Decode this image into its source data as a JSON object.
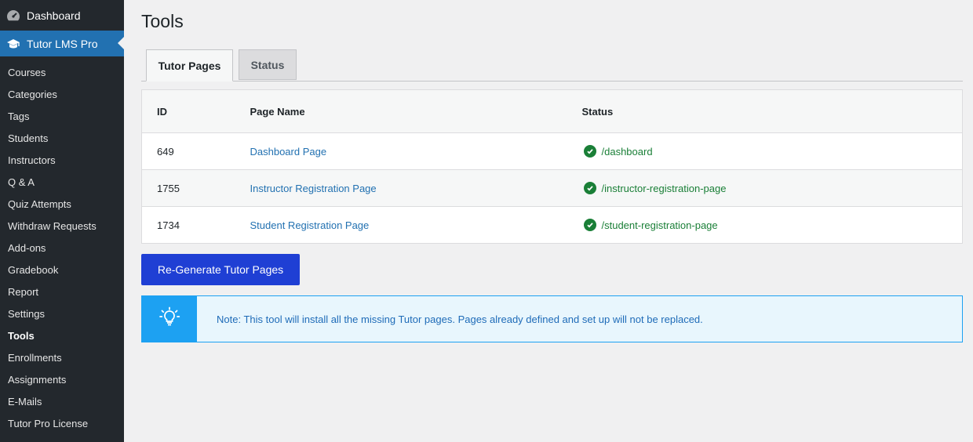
{
  "sidebar": {
    "dashboard": {
      "label": "Dashboard",
      "icon": "dashboard-icon"
    },
    "plugin": {
      "label": "Tutor LMS Pro",
      "icon": "graduation-cap-icon"
    },
    "items": [
      {
        "label": "Courses"
      },
      {
        "label": "Categories"
      },
      {
        "label": "Tags"
      },
      {
        "label": "Students"
      },
      {
        "label": "Instructors"
      },
      {
        "label": "Q & A"
      },
      {
        "label": "Quiz Attempts"
      },
      {
        "label": "Withdraw Requests"
      },
      {
        "label": "Add-ons"
      },
      {
        "label": "Gradebook"
      },
      {
        "label": "Report"
      },
      {
        "label": "Settings"
      },
      {
        "label": "Tools"
      },
      {
        "label": "Enrollments"
      },
      {
        "label": "Assignments"
      },
      {
        "label": "E-Mails"
      },
      {
        "label": "Tutor Pro License"
      }
    ],
    "current": "Tools"
  },
  "page": {
    "title": "Tools"
  },
  "tabs": [
    {
      "label": "Tutor Pages",
      "active": true
    },
    {
      "label": "Status",
      "active": false
    }
  ],
  "table": {
    "headers": {
      "id": "ID",
      "name": "Page Name",
      "status": "Status"
    },
    "rows": [
      {
        "id": "649",
        "name": "Dashboard Page",
        "status": "/dashboard"
      },
      {
        "id": "1755",
        "name": "Instructor Registration Page",
        "status": "/instructor-registration-page"
      },
      {
        "id": "1734",
        "name": "Student Registration Page",
        "status": "/student-registration-page"
      }
    ]
  },
  "regen_button": {
    "label": "Re-Generate Tutor Pages"
  },
  "note": {
    "icon": "lightbulb-icon",
    "text": "Note: This tool will install all the missing Tutor pages. Pages already defined and set up will not be replaced."
  },
  "colors": {
    "sidebar_bg": "#23282d",
    "accent": "#2271b1",
    "button": "#1f3fd4",
    "success": "#1a7f37",
    "info": "#1da1f2"
  }
}
